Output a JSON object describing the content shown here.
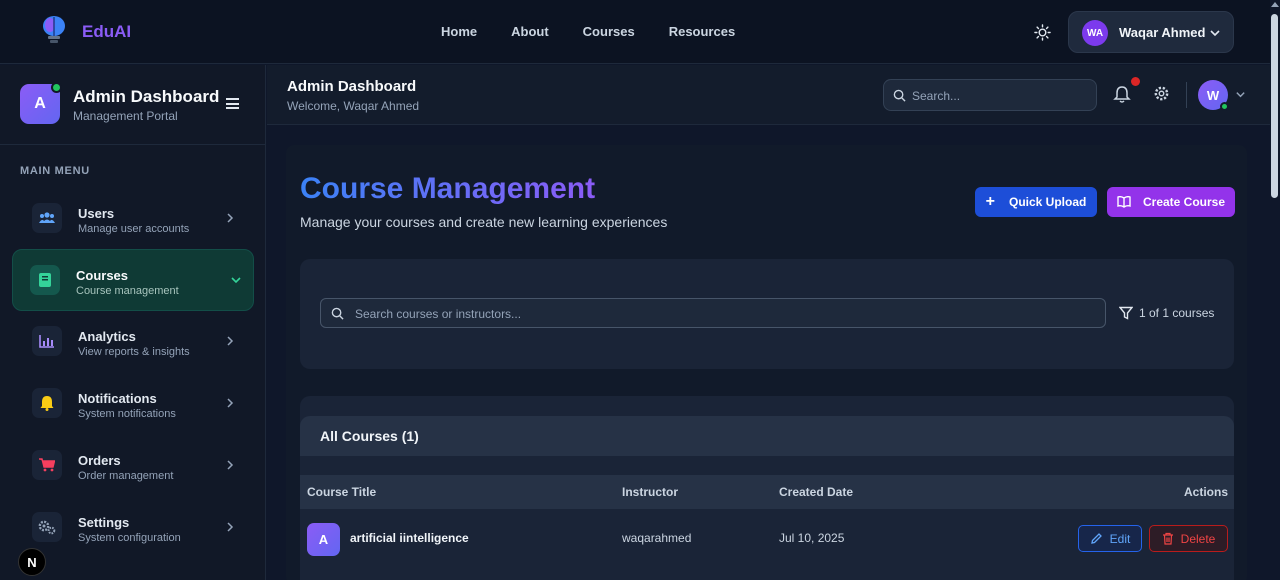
{
  "topnav": {
    "brand": "EduAI",
    "links": [
      "Home",
      "About",
      "Courses",
      "Resources"
    ],
    "user_initials": "WA",
    "user_name": "Waqar Ahmed"
  },
  "sidebar": {
    "avatar_letter": "A",
    "title": "Admin Dashboard",
    "subtitle": "Management Portal",
    "menu_label": "MAIN MENU",
    "items": [
      {
        "label": "Users",
        "sub": "Manage user accounts",
        "icon": "users-icon",
        "color": "#60a5fa"
      },
      {
        "label": "Courses",
        "sub": "Course management",
        "icon": "book-icon",
        "color": "#34d399",
        "active": true
      },
      {
        "label": "Analytics",
        "sub": "View reports & insights",
        "icon": "chart-icon",
        "color": "#a78bfa"
      },
      {
        "label": "Notifications",
        "sub": "System notifications",
        "icon": "bell-icon",
        "color": "#facc15"
      },
      {
        "label": "Orders",
        "sub": "Order management",
        "icon": "cart-icon",
        "color": "#f43f5e"
      },
      {
        "label": "Settings",
        "sub": "System configuration",
        "icon": "gears-icon",
        "color": "#94a3b8"
      }
    ],
    "badge_letter": "N"
  },
  "header": {
    "title": "Admin Dashboard",
    "welcome": "Welcome, Waqar Ahmed",
    "search_placeholder": "Search...",
    "avatar_letter": "W"
  },
  "main": {
    "title": "Course Management",
    "subtitle": "Manage your courses and create new learning experiences",
    "quick_upload": "Quick Upload",
    "create_course": "Create Course",
    "search_placeholder": "Search courses or instructors...",
    "count": "1 of 1 courses",
    "table_title": "All Courses (1)",
    "columns": [
      "Course Title",
      "Instructor",
      "Created Date",
      "Actions"
    ],
    "rows": [
      {
        "letter": "A",
        "title": "artificial iintelligence",
        "instructor": "waqarahmed",
        "date": "Jul 10, 2025"
      }
    ],
    "edit_label": "Edit",
    "delete_label": "Delete"
  },
  "colors": {
    "accent_blue": "#1d4ed8",
    "accent_purple": "#9333ea",
    "active_green": "#0f3a35"
  }
}
